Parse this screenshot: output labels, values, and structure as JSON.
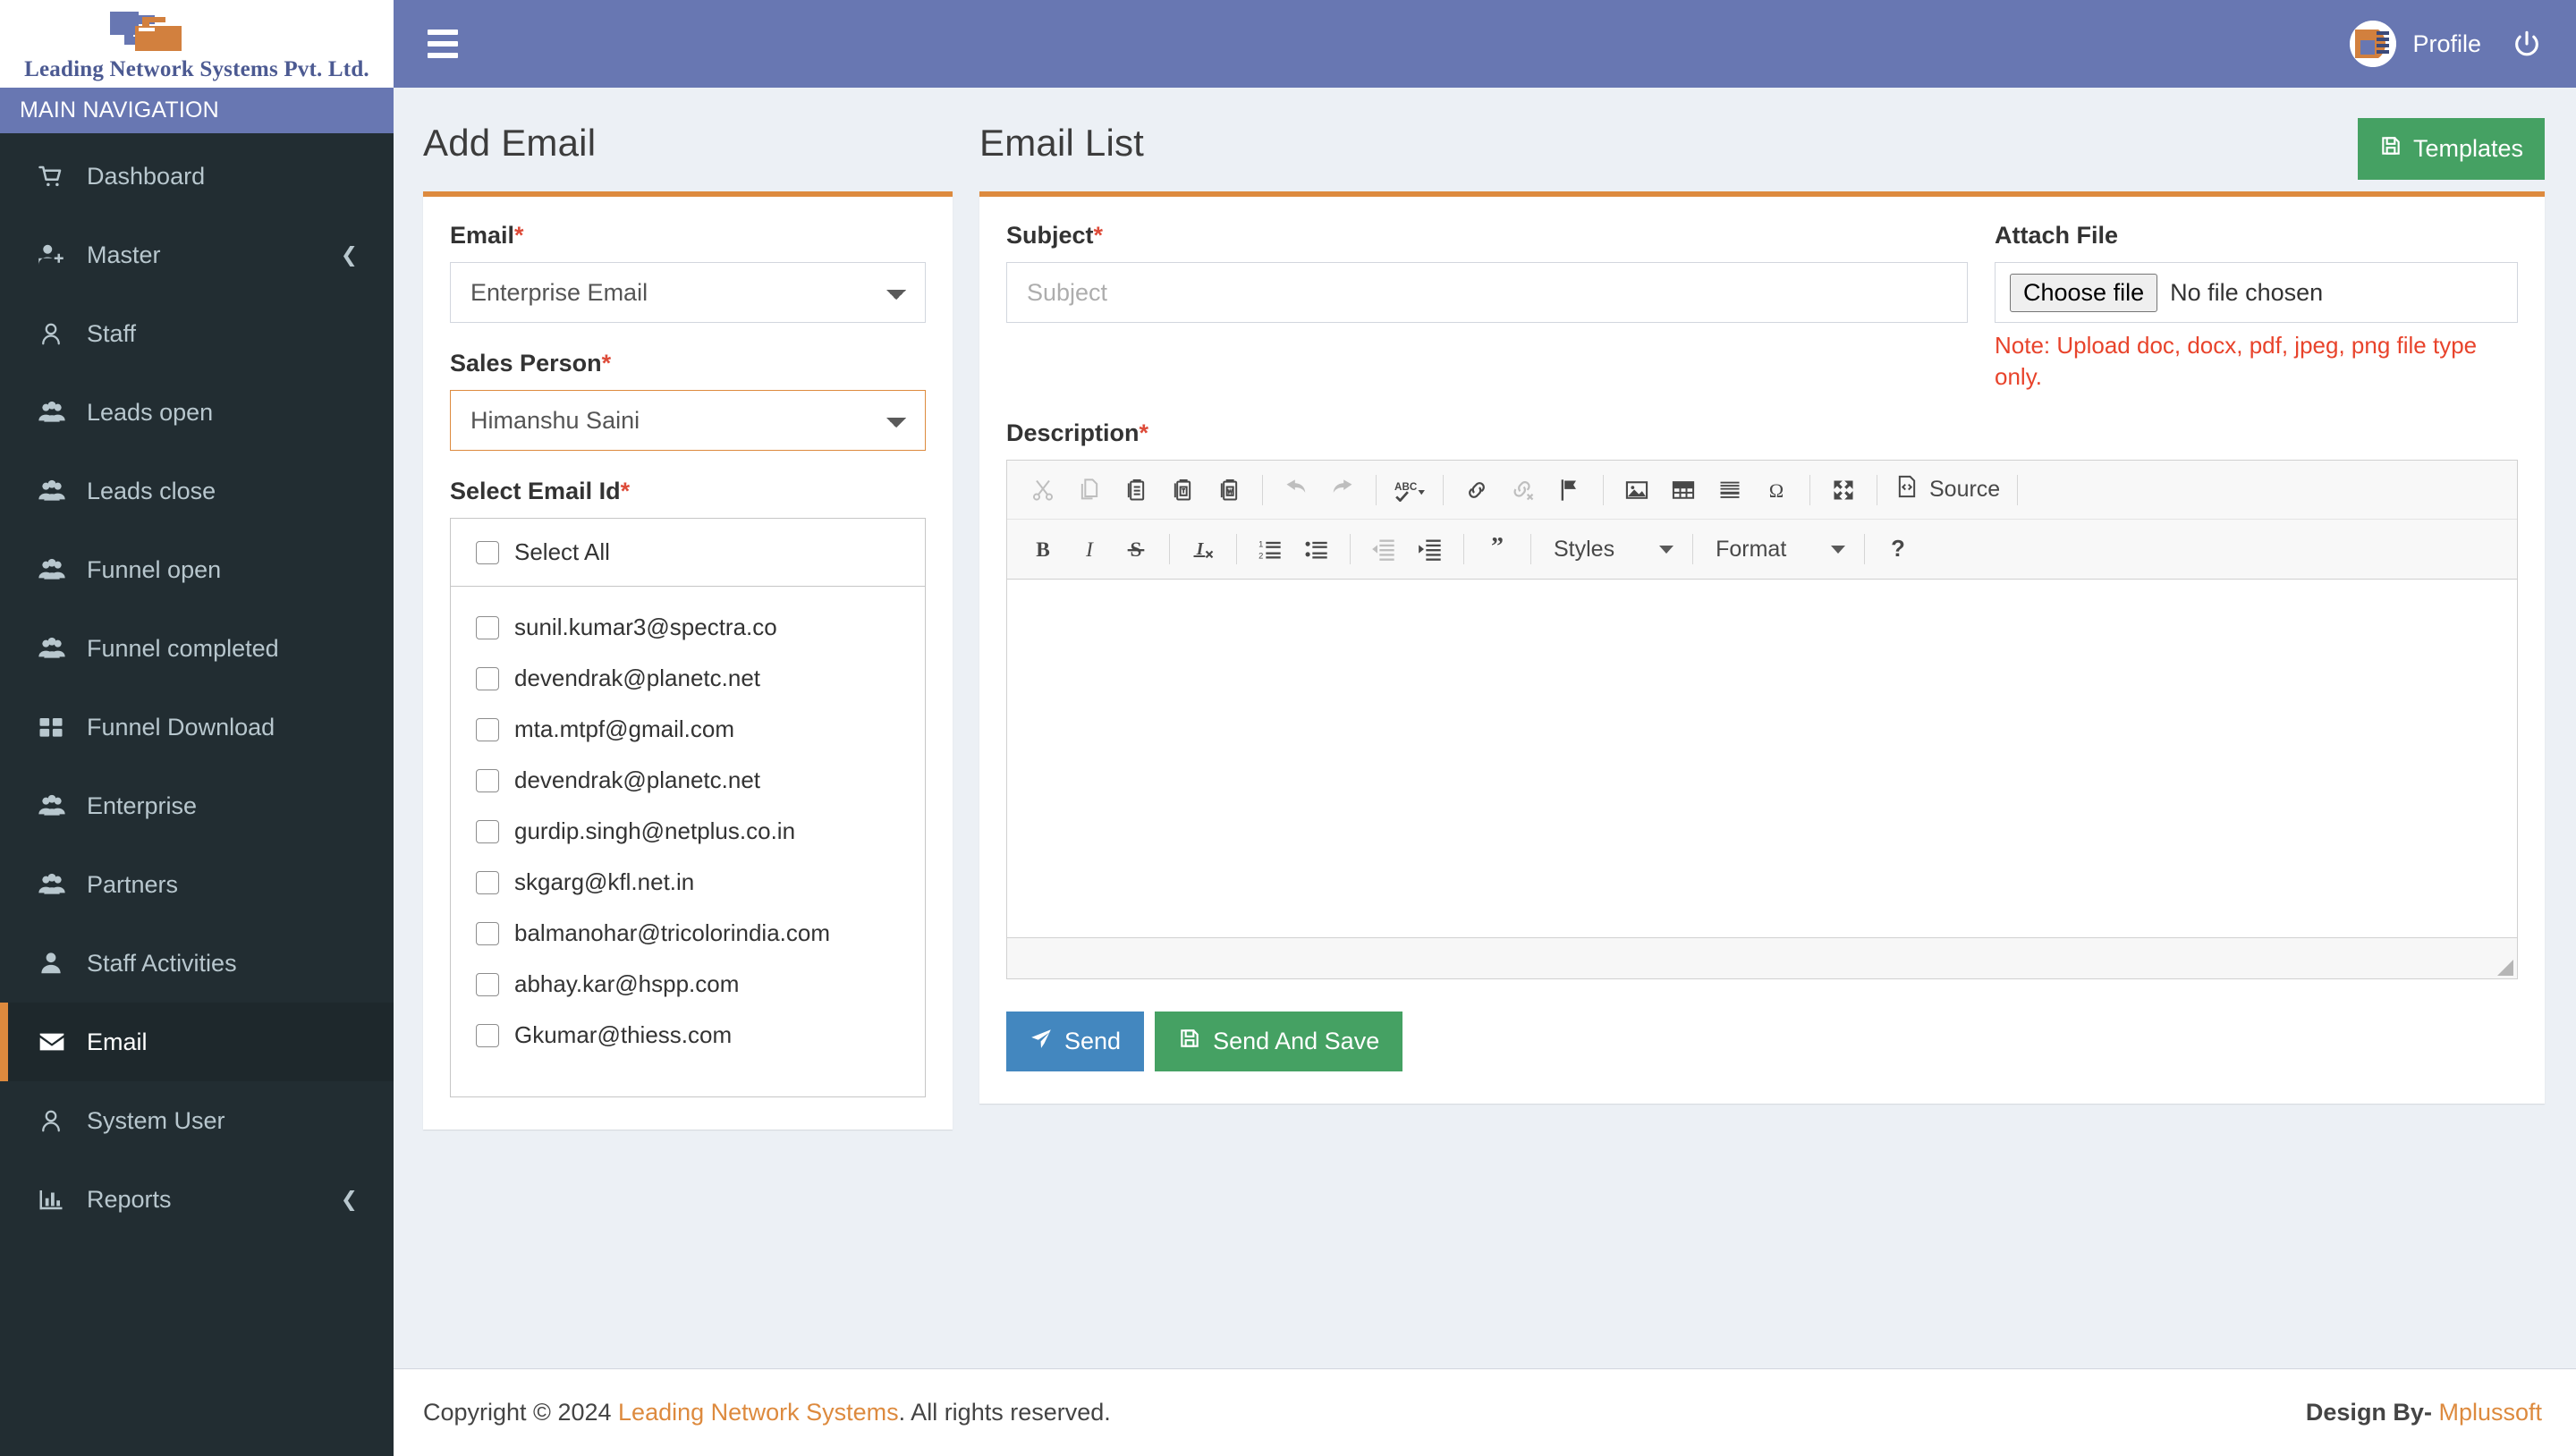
{
  "brand": {
    "company_name": "Leading Network Systems Pvt. Ltd.",
    "nav_header": "MAIN NAVIGATION",
    "accent_orange": "#dd8a3e",
    "header_blue": "#6877b2",
    "sidebar_dark": "#222d32"
  },
  "topbar": {
    "menu_icon": "hamburger-icon",
    "profile_label": "Profile",
    "logout_icon": "power-icon"
  },
  "sidebar": {
    "items": [
      {
        "label": "Dashboard",
        "icon": "cart-icon",
        "active": false,
        "chevron": false
      },
      {
        "label": "Master",
        "icon": "user-plus-icon",
        "active": false,
        "chevron": true
      },
      {
        "label": "Staff",
        "icon": "user-icon",
        "active": false,
        "chevron": false
      },
      {
        "label": "Leads open",
        "icon": "users-icon",
        "active": false,
        "chevron": false
      },
      {
        "label": "Leads close",
        "icon": "users-icon",
        "active": false,
        "chevron": false
      },
      {
        "label": "Funnel open",
        "icon": "users-icon",
        "active": false,
        "chevron": false
      },
      {
        "label": "Funnel completed",
        "icon": "users-icon",
        "active": false,
        "chevron": false
      },
      {
        "label": "Funnel Download",
        "icon": "grid-icon",
        "active": false,
        "chevron": false
      },
      {
        "label": "Enterprise",
        "icon": "users-icon",
        "active": false,
        "chevron": false
      },
      {
        "label": "Partners",
        "icon": "users-icon",
        "active": false,
        "chevron": false
      },
      {
        "label": "Staff Activities",
        "icon": "user-solid-icon",
        "active": false,
        "chevron": false
      },
      {
        "label": "Email",
        "icon": "envelope-icon",
        "active": true,
        "chevron": false
      },
      {
        "label": "System User",
        "icon": "user-icon",
        "active": false,
        "chevron": false
      },
      {
        "label": "Reports",
        "icon": "bar-chart-icon",
        "active": false,
        "chevron": true
      }
    ]
  },
  "add_email": {
    "title": "Add Email",
    "email_label": "Email",
    "email_value": "Enterprise Email",
    "email_options": [
      "Enterprise Email"
    ],
    "sales_person_label": "Sales Person",
    "sales_person_value": "Himanshu Saini",
    "sales_person_options": [
      "Himanshu Saini"
    ],
    "select_email_id_label": "Select Email Id",
    "select_all_label": "Select All",
    "emails": [
      "sunil.kumar3@spectra.co",
      "devendrak@planetc.net",
      "mta.mtpf@gmail.com",
      "devendrak@planetc.net",
      "gurdip.singh@netplus.co.in",
      "skgarg@kfl.net.in",
      "balmanohar@tricolorindia.com",
      "abhay.kar@hspp.com",
      "Gkumar@thiess.com"
    ]
  },
  "email_list": {
    "title": "Email List",
    "templates_button": "Templates",
    "templates_icon": "save-icon",
    "subject_label": "Subject",
    "subject_value": "",
    "subject_placeholder": "Subject",
    "attach_file_label": "Attach File",
    "choose_file_label": "Choose file",
    "no_file_chosen": "No file chosen",
    "upload_note": "Note: Upload doc, docx, pdf, jpeg, png file type only.",
    "description_label": "Description",
    "description_value": "",
    "send_label": "Send",
    "send_icon": "paper-plane-icon",
    "send_and_save_label": "Send And Save",
    "send_and_save_icon": "save-icon"
  },
  "editor_toolbar": {
    "row1": [
      {
        "name": "cut-icon",
        "dim": true
      },
      {
        "name": "copy-icon",
        "dim": true
      },
      {
        "name": "paste-icon",
        "dim": false
      },
      {
        "name": "paste-text-icon",
        "dim": false
      },
      {
        "name": "paste-word-icon",
        "dim": false
      },
      {
        "sep": true
      },
      {
        "name": "undo-icon",
        "dim": true
      },
      {
        "name": "redo-icon",
        "dim": true
      },
      {
        "sep": true
      },
      {
        "name": "spellcheck-icon",
        "dim": false
      },
      {
        "sep": true
      },
      {
        "name": "link-icon",
        "dim": false
      },
      {
        "name": "unlink-icon",
        "dim": true
      },
      {
        "name": "anchor-flag-icon",
        "dim": false
      },
      {
        "sep": true
      },
      {
        "name": "image-icon",
        "dim": false
      },
      {
        "name": "table-icon",
        "dim": false
      },
      {
        "name": "horizontal-rule-icon",
        "dim": false
      },
      {
        "name": "special-character-icon",
        "dim": false
      },
      {
        "sep": true
      },
      {
        "name": "maximize-icon",
        "dim": false
      },
      {
        "sep": true
      }
    ],
    "source_label": "Source",
    "row2": [
      {
        "name": "bold-icon",
        "dim": false
      },
      {
        "name": "italic-icon",
        "dim": false
      },
      {
        "name": "strikethrough-icon",
        "dim": false
      },
      {
        "sep": true
      },
      {
        "name": "remove-format-icon",
        "dim": false
      },
      {
        "sep": true
      },
      {
        "name": "numbered-list-icon",
        "dim": false
      },
      {
        "name": "bulleted-list-icon",
        "dim": false
      },
      {
        "sep": true
      },
      {
        "name": "outdent-icon",
        "dim": true
      },
      {
        "name": "indent-icon",
        "dim": false
      },
      {
        "sep": true
      },
      {
        "name": "blockquote-icon",
        "dim": false
      },
      {
        "sep": true
      }
    ],
    "styles_label": "Styles",
    "format_label": "Format",
    "about_label": "?"
  },
  "footer": {
    "copyright_prefix": "Copyright © 2024",
    "company_link": "Leading Network Systems",
    "copyright_suffix": ". All rights reserved.",
    "design_by_prefix": "Design By-",
    "design_by_brand": "Mplussoft"
  }
}
